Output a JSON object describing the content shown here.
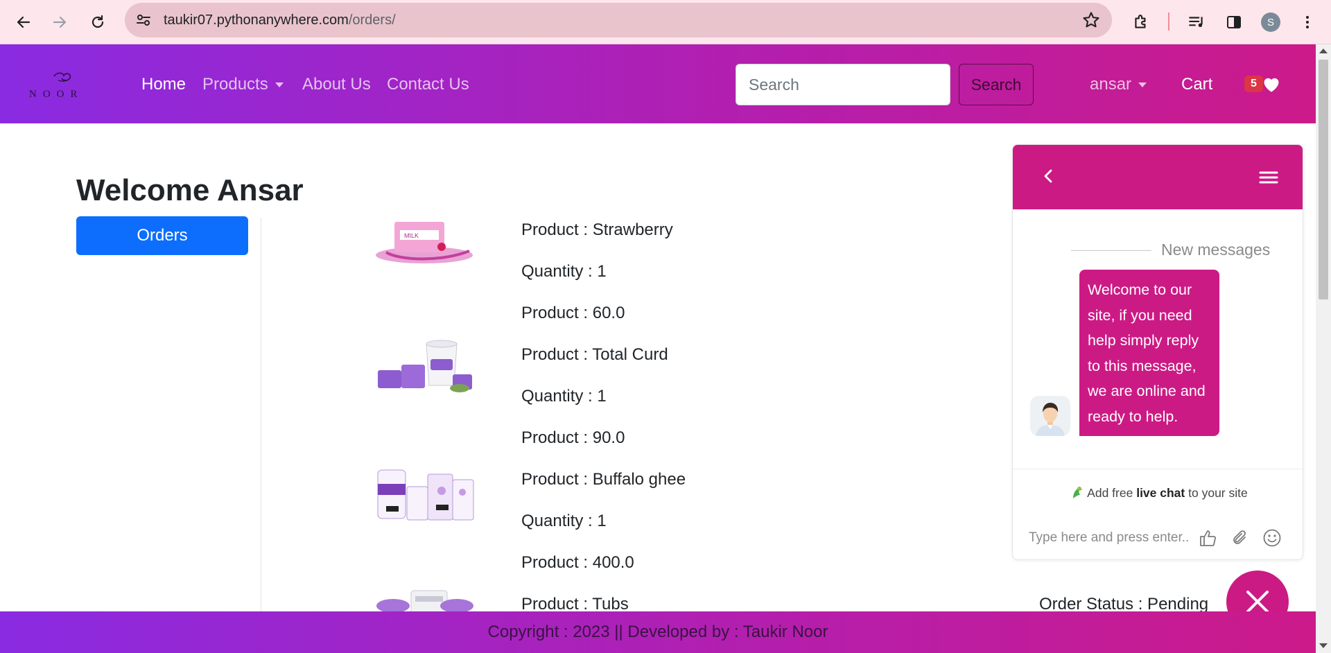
{
  "browser": {
    "url_host": "taukir07.pythonanywhere.com",
    "url_path": "/orders/",
    "profile_initial": "S"
  },
  "nav": {
    "logo_text": "NOOR",
    "links": [
      "Home",
      "Products",
      "About Us",
      "Contact Us"
    ],
    "search_placeholder": "Search",
    "search_button": "Search",
    "user": "ansar",
    "cart": "Cart",
    "wishlist_count": "5"
  },
  "main": {
    "welcome": "Welcome Ansar",
    "orders_button": "Orders",
    "orders": [
      {
        "product": "Product : Strawberry",
        "quantity": "Quantity : 1",
        "price": "Product : 60.0",
        "image": "strawberry-milk-icon"
      },
      {
        "product": "Product : Total Curd",
        "quantity": "Quantity : 1",
        "price": "Product : 90.0",
        "image": "curd-pack-icon"
      },
      {
        "product": "Product : Buffalo ghee",
        "quantity": "Quantity : 1",
        "price": "Product : 400.0",
        "image": "ghee-pack-icon"
      },
      {
        "product": "Product : Tubs",
        "image": "tubs-icon"
      }
    ],
    "order_status": "Order Status : Pending"
  },
  "chat": {
    "new_messages": "New messages",
    "welcome_message": "Welcome to our site, if you need help simply reply to this message, we are online and ready to help.",
    "powered_prefix": "Add free",
    "powered_bold": "live chat",
    "powered_suffix": "to your site",
    "input_placeholder": "Type here and press enter.."
  },
  "footer": {
    "text": "Copyright : 2023 || Developed by : Taukir Noor"
  },
  "colors": {
    "nav_gradient_start": "#8a2be2",
    "nav_gradient_end": "#cc1a8a",
    "chat_accent": "#cc1a84",
    "primary_button": "#0d6efd",
    "badge": "#dc3545"
  }
}
